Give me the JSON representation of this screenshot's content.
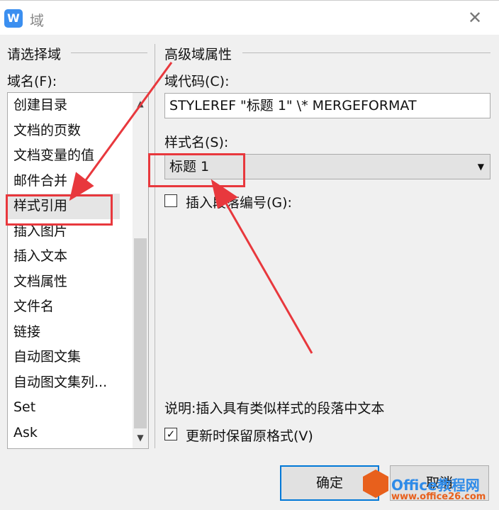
{
  "window": {
    "title": "域",
    "logo": "W",
    "close": "✕"
  },
  "left": {
    "group": "请选择域",
    "field_label": "域名(F):",
    "items": [
      "创建目录",
      "文档的页数",
      "文档变量的值",
      "邮件合并",
      "样式引用",
      "插入图片",
      "插入文本",
      "文档属性",
      "文件名",
      "链接",
      "自动图文集",
      "自动图文集列...",
      "Set",
      "Ask"
    ],
    "selected": "样式引用"
  },
  "right": {
    "group": "高级域属性",
    "code_label": "域代码(C):",
    "code_value": "STYLEREF \"标题 1\" \\* MERGEFORMAT",
    "style_label": "样式名(S):",
    "style_value": "标题 1",
    "insert_para_label": "插入段落编号(G):",
    "insert_para_checked": false,
    "description": "说明:插入具有类似样式的段落中文本",
    "keep_format_label": "更新时保留原格式(V)",
    "keep_format_checked": true
  },
  "buttons": {
    "ok": "确定",
    "cancel": "取消"
  },
  "watermark": {
    "brand": "Office教程网",
    "url": "www.office26.com"
  },
  "colors": {
    "accent": "#0078d7",
    "annotation": "#e8383d"
  }
}
